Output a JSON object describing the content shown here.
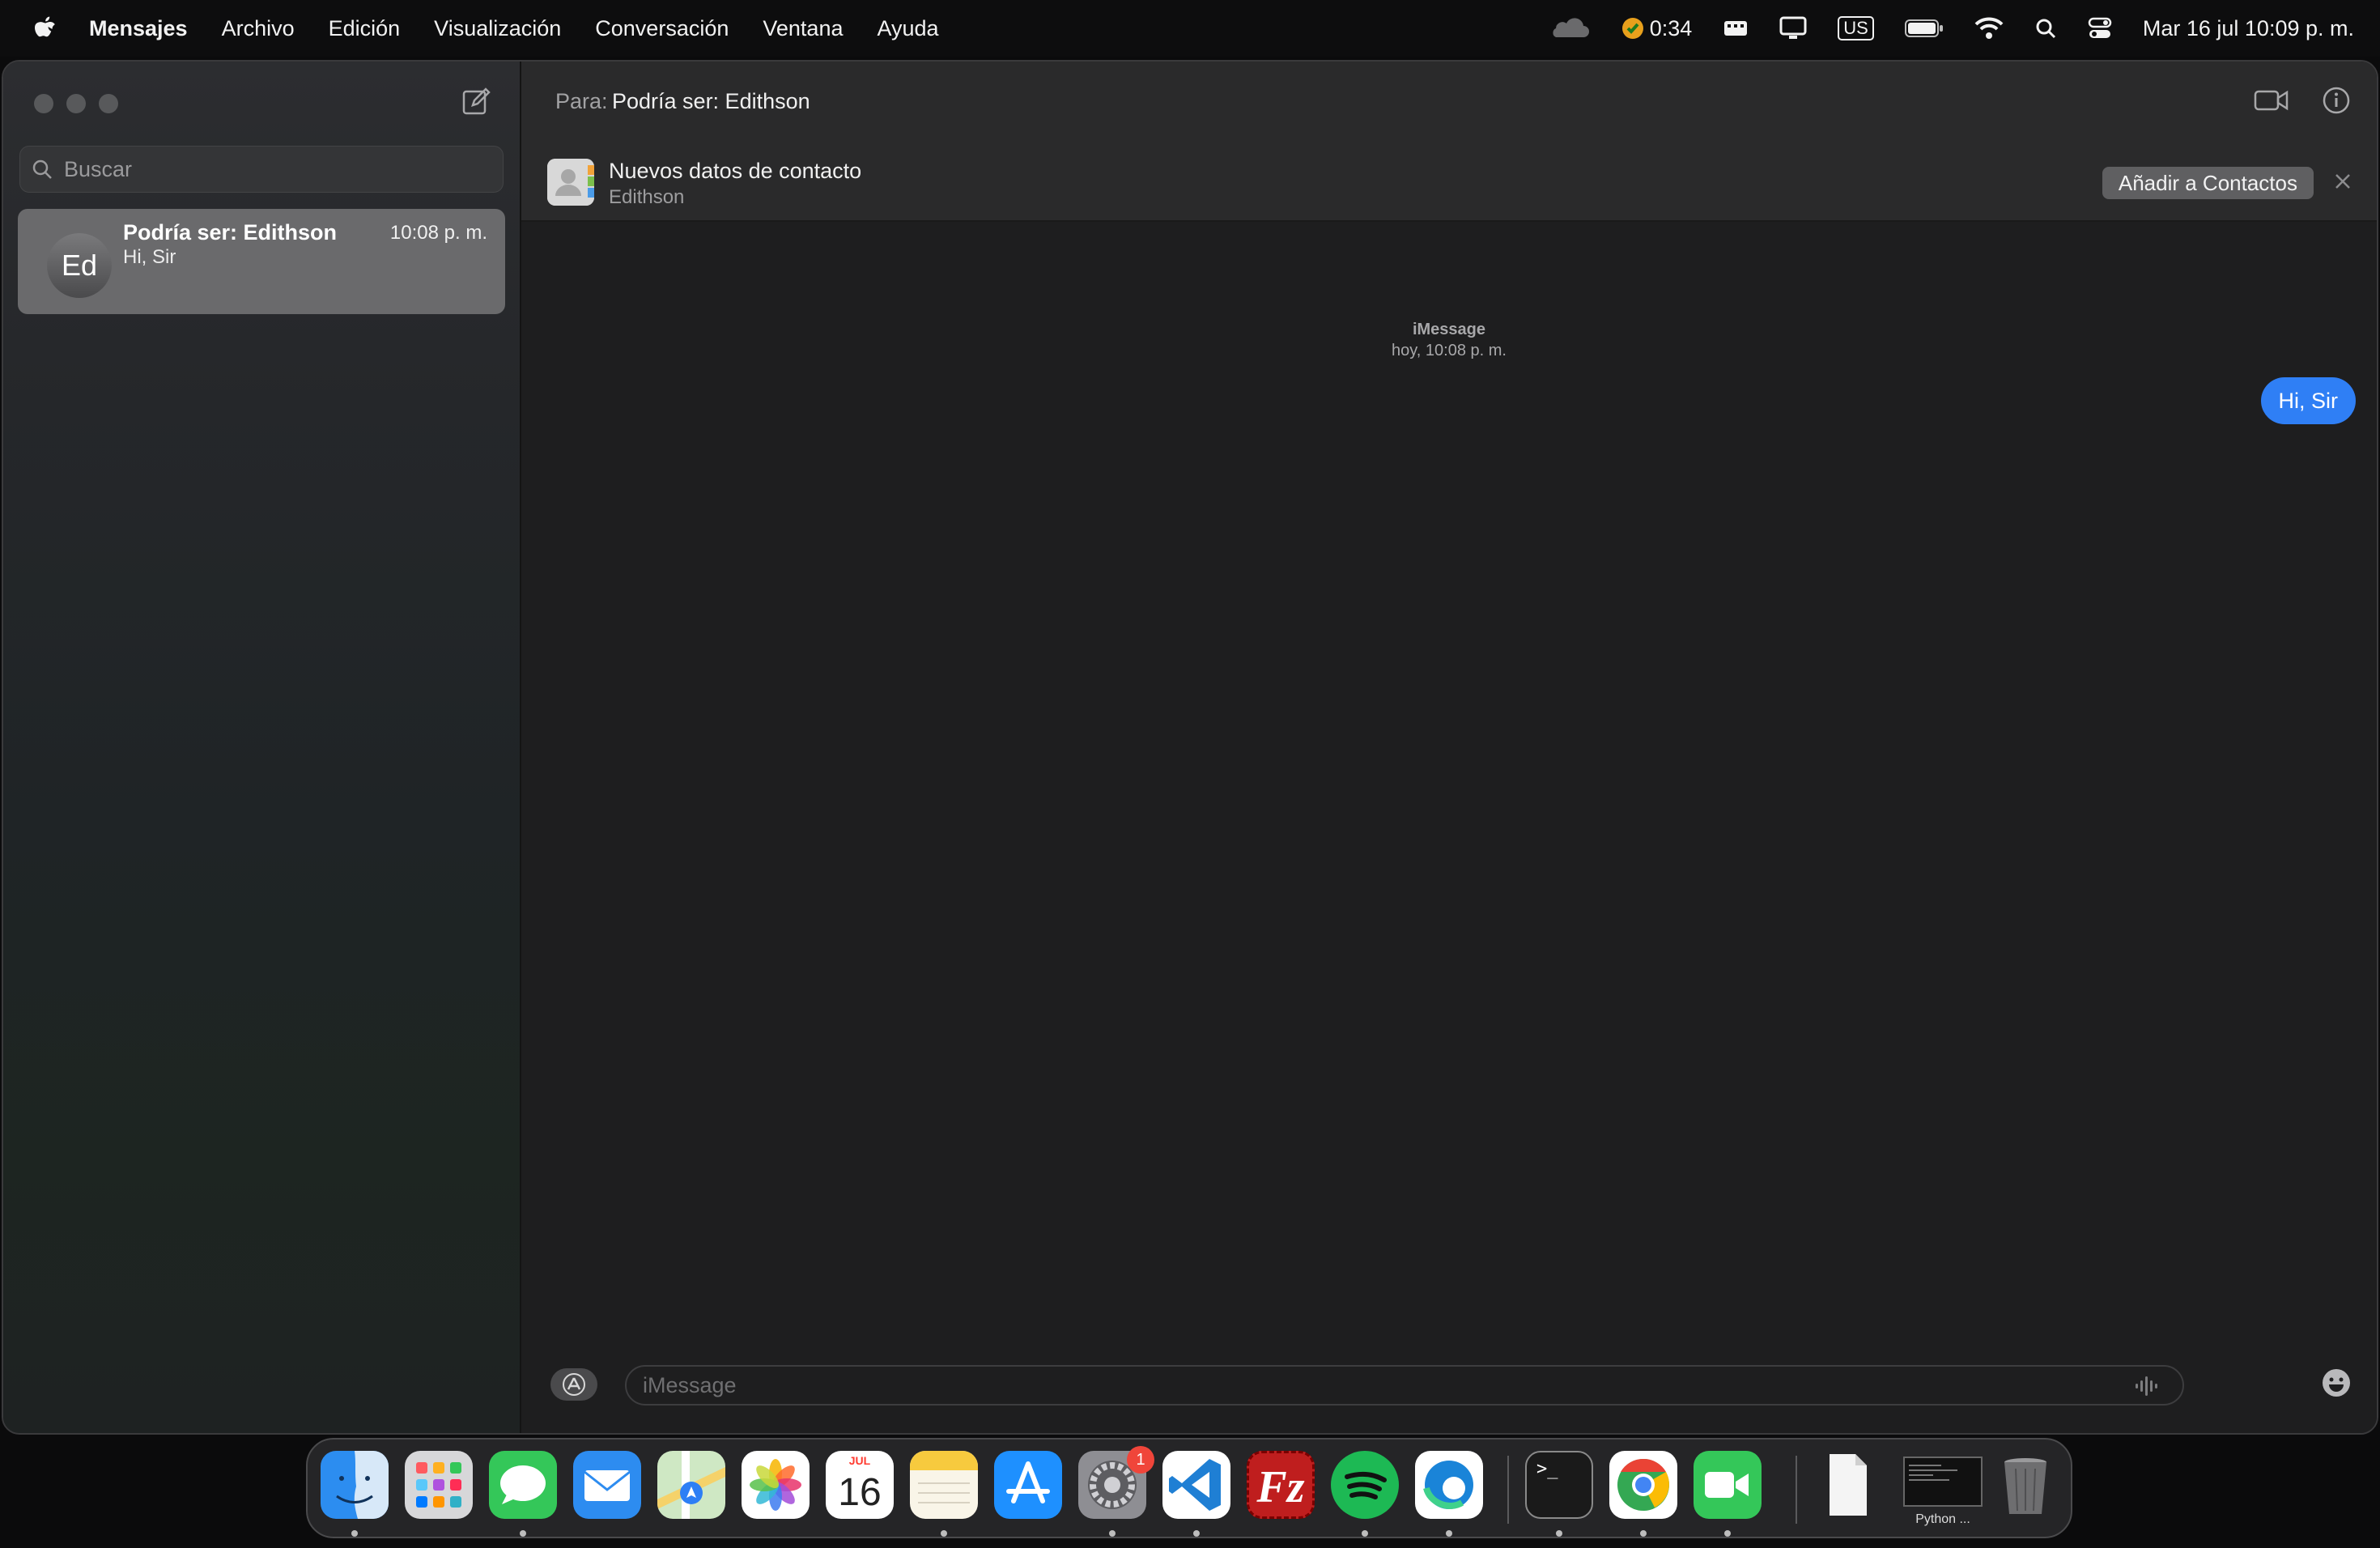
{
  "menubar": {
    "app_name": "Mensajes",
    "items": [
      "Archivo",
      "Edición",
      "Visualización",
      "Conversación",
      "Ventana",
      "Ayuda"
    ],
    "timer": "0:34",
    "keyboard_layout": "US",
    "datetime": "Mar 16 jul 10:09 p. m."
  },
  "sidebar": {
    "search_placeholder": "Buscar",
    "conversations": [
      {
        "initials": "Ed",
        "name": "Podría ser: Edithson",
        "time": "10:08 p. m.",
        "preview": "Hi, Sir"
      }
    ]
  },
  "header": {
    "to_label": "Para:",
    "recipient": "Podría ser: Edithson"
  },
  "banner": {
    "title": "Nuevos datos de contacto",
    "subtitle": "Edithson",
    "button_label": "Añadir a Contactos"
  },
  "thread": {
    "service": "iMessage",
    "timestamp": "hoy, 10:08 p. m.",
    "messages": [
      {
        "direction": "sent",
        "text": "Hi, Sir"
      }
    ]
  },
  "composer": {
    "placeholder": "iMessage"
  },
  "dock": {
    "calendar_month": "JUL",
    "calendar_day": "16",
    "settings_badge": "1",
    "window_thumbnail_label": "Python ...",
    "apps": [
      "finder",
      "launchpad",
      "messages",
      "mail",
      "maps",
      "photos",
      "calendar",
      "notes",
      "app-store",
      "system-settings",
      "vscode",
      "filezilla",
      "spotify",
      "edge",
      "terminal",
      "chrome",
      "facetime",
      "document",
      "python-window",
      "trash"
    ]
  },
  "colors": {
    "accent_blue": "#2f7ff5",
    "badge_red": "#f0453a",
    "window_bg": "#1e1e1f"
  }
}
